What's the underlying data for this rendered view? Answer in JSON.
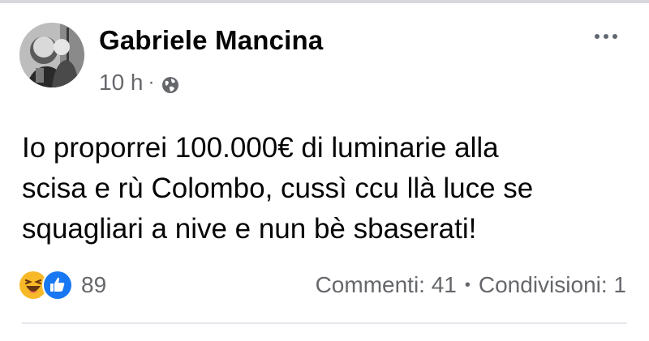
{
  "post": {
    "author": "Gabriele Mancina",
    "time": "10 h",
    "meta_separator": "·",
    "privacy_icon": "globe-icon",
    "more_icon": "more-horizontal-icon",
    "text": "Io proporrei 100.000€ di luminarie alla\nscisa e rù Colombo, cussì ccu llà luce se\nsquagliari a nive e nun bè sbaserati!"
  },
  "footer": {
    "reaction_icons": [
      "haha-icon",
      "like-icon"
    ],
    "reaction_count": "89",
    "comments": "Commenti: 41",
    "separator": "•",
    "shares": "Condivisioni: 1"
  },
  "colors": {
    "text_primary": "#050505",
    "text_secondary": "#65676b",
    "like_blue": "#1877f2",
    "haha_yellow": "#f7b928",
    "divider": "#e4e6eb"
  }
}
